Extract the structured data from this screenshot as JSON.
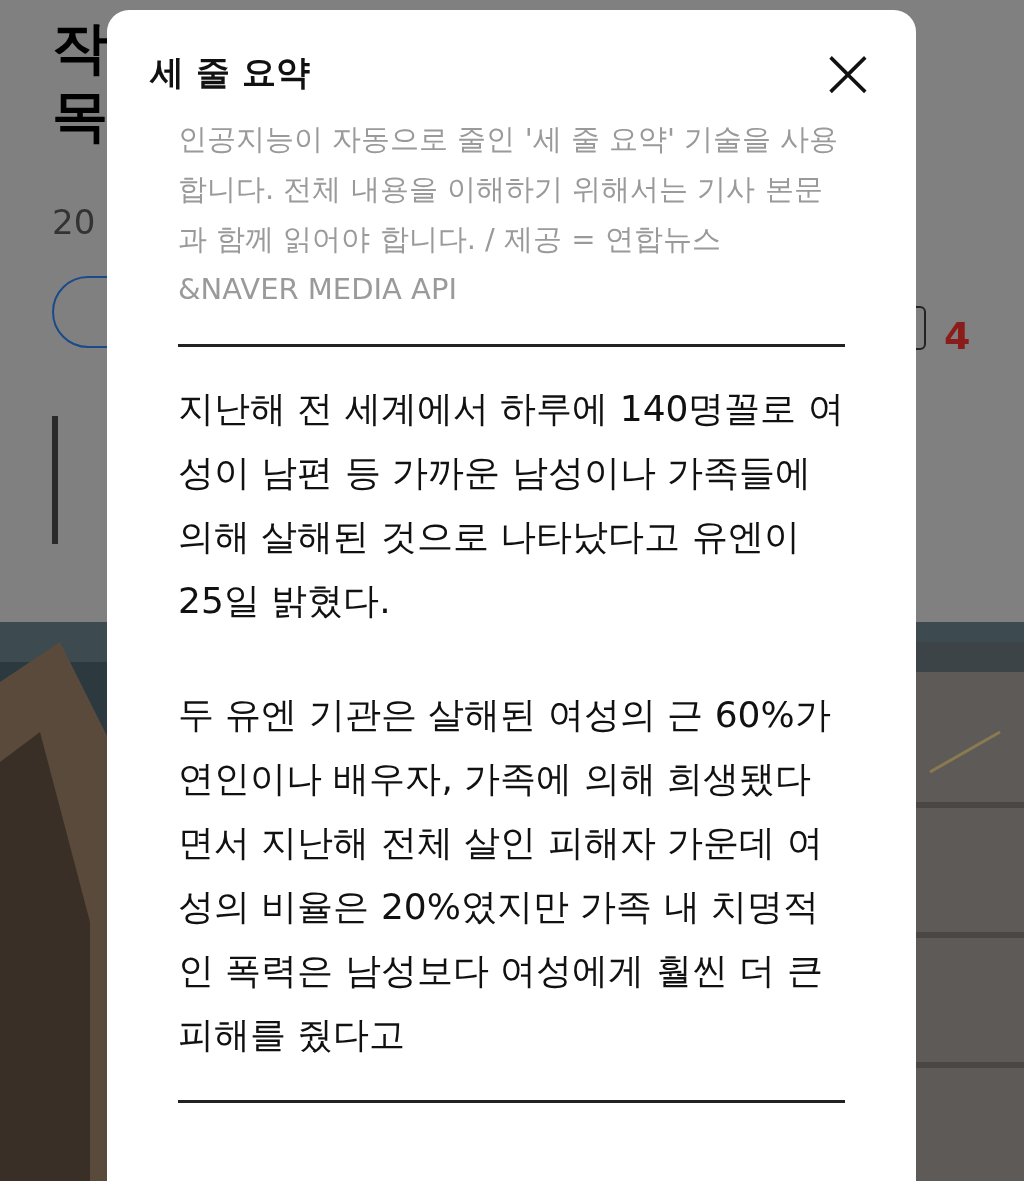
{
  "article": {
    "title_lines": [
      "작",
      "목"
    ],
    "date": "20",
    "comment_count": "4"
  },
  "modal": {
    "title": "세 줄 요약",
    "close": "×",
    "notice": "인공지능이 자동으로 줄인 '세 줄 요약' 기술을 사용 합니다. 전체 내용을 이해하기 위해서는 기사 본문과 함께 읽어야 합니다. / 제공 = 연합뉴스 &NAVER MEDIA API",
    "paragraphs": [
      "지난해 전 세계에서 하루에 140명꼴로 여성이 남편 등 가까운 남성이나 가족들에 의해 살해된 것으로 나타났다고 유엔이 25일 밝혔다.",
      "두 유엔 기관은 살해된 여성의 근 60%가 연인이나 배우자, 가족에 의해 희생됐다면서 지난해 전체 살인 피해자 가운데 여성의 비율은 20%였지만 가족 내 치명적인 폭력은 남성보다 여성에게 훨씬 더 큰 피해를 줬다고"
    ]
  }
}
